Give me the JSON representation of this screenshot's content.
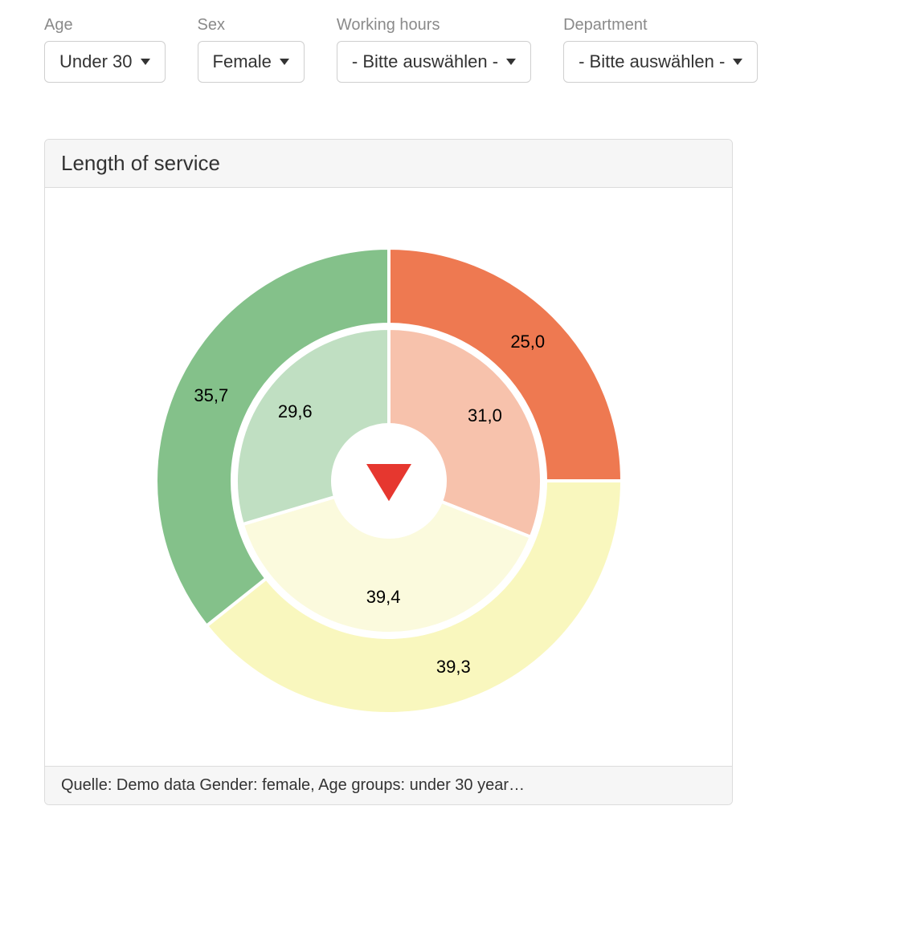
{
  "filters": {
    "age": {
      "label": "Age",
      "value": "Under 30"
    },
    "sex": {
      "label": "Sex",
      "value": "Female"
    },
    "hours": {
      "label": "Working hours",
      "value": "- Bitte auswählen -"
    },
    "dept": {
      "label": "Department",
      "value": "- Bitte auswählen -"
    }
  },
  "panel": {
    "title": "Length of service",
    "footer": "Quelle: Demo data Gender: female, Age groups: under 30 year…"
  },
  "chart_data": {
    "type": "pie",
    "title": "Length of service",
    "rings": [
      {
        "name": "outer",
        "slices": [
          {
            "label": "25,0",
            "value": 25.0,
            "color": "#ee7951"
          },
          {
            "label": "39,3",
            "value": 39.3,
            "color": "#f9f7be"
          },
          {
            "label": "35,7",
            "value": 35.7,
            "color": "#84c18a"
          }
        ]
      },
      {
        "name": "inner",
        "slices": [
          {
            "label": "31,0",
            "value": 31.0,
            "color": "#f7c2ac"
          },
          {
            "label": "39,4",
            "value": 39.4,
            "color": "#fbfadd"
          },
          {
            "label": "29,6",
            "value": 29.6,
            "color": "#c0dfc2"
          }
        ]
      }
    ],
    "center_indicator": "down-triangle-red"
  }
}
